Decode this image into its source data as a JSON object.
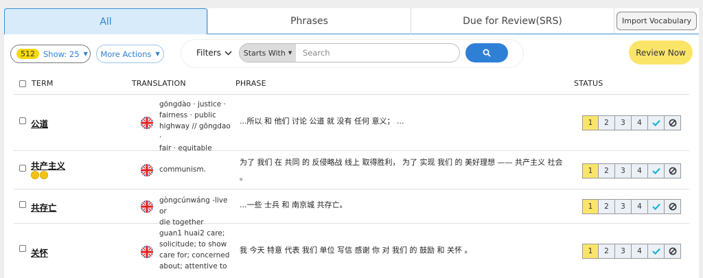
{
  "tabs": {
    "all": "All",
    "phrases": "Phrases",
    "due": "Due for Review(SRS)",
    "import": "Import Vocabulary"
  },
  "toolbar": {
    "count": "512",
    "show_label": "Show: 25",
    "more_actions": "More Actions",
    "filters": "Filters",
    "starts_with": "Starts With",
    "search_placeholder": "Search",
    "review_now": "Review Now"
  },
  "table": {
    "headers": {
      "term": "TERM",
      "translation": "TRANSLATION",
      "phrase": "PHRASE",
      "status": "STATUS"
    },
    "status_levels": [
      "1",
      "2",
      "3",
      "4"
    ],
    "rows": [
      {
        "term": "公道",
        "coins": 0,
        "translation": [
          "gōngdào · justice ·",
          "fairness · public",
          "highway // gōngdao ·",
          "fair · equitable"
        ],
        "phrase": [
          "...所以 和 他们 讨论 公道 就 没有 任何 意义； ..."
        ],
        "status": "1"
      },
      {
        "term": "共产主义",
        "coins": 2,
        "translation": [
          "communism."
        ],
        "phrase": [
          "为了 我们 在 共同 的 反侵略战 线上 取得胜利， 为了 实现 我们 的 美好理想 —— 共产主义 社会",
          "。"
        ],
        "status": "1"
      },
      {
        "term": "共存亡",
        "coins": 0,
        "translation": [
          "gòngcúnwáng -live or",
          "die together"
        ],
        "phrase": [
          "...一些 士兵 和 南京城 共存亡。"
        ],
        "status": "1"
      },
      {
        "term": "关怀",
        "coins": 0,
        "translation": [
          "guan1 huai2 care;",
          "solicitude; to show",
          "care for; concerned",
          "about; attentive to"
        ],
        "phrase": [
          "我 今天 特意 代表 我们 单位 写信 感谢 你 对 我们 的 鼓励 和 关怀 。"
        ],
        "status": "1"
      }
    ]
  }
}
